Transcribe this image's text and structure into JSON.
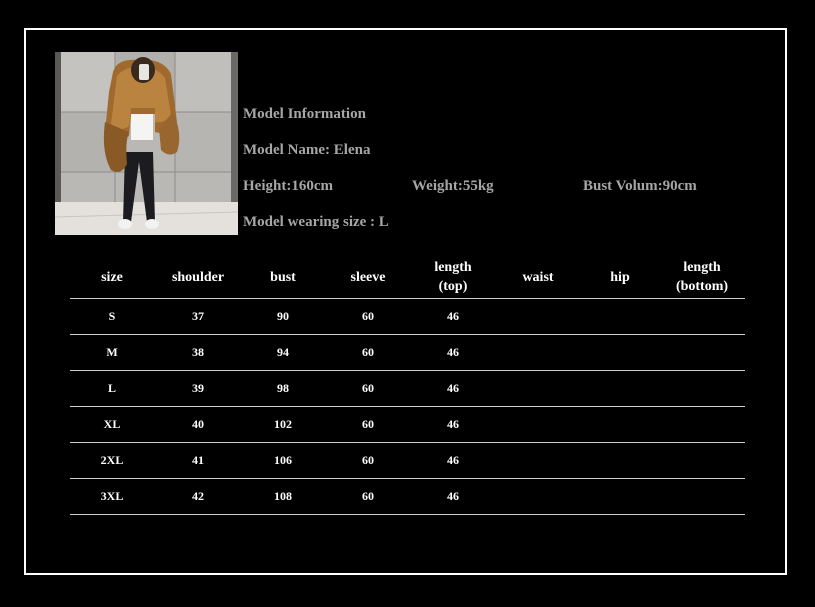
{
  "model": {
    "heading": "Model Information",
    "name": "Model Name: Elena",
    "height": "Height:160cm",
    "weight": "Weight:55kg",
    "bust": "Bust Volum:90cm",
    "wearing_size": "Model wearing size : L",
    "text_color": "#a6a6a6"
  },
  "table": {
    "headers": [
      [
        "size"
      ],
      [
        "shoulder"
      ],
      [
        "bust"
      ],
      [
        "sleeve"
      ],
      [
        "length",
        "(top)"
      ],
      [
        "waist"
      ],
      [
        "hip"
      ],
      [
        "length",
        "(bottom)"
      ]
    ],
    "rows": [
      [
        "S",
        "37",
        "90",
        "60",
        "46",
        "",
        "",
        ""
      ],
      [
        "M",
        "38",
        "94",
        "60",
        "46",
        "",
        "",
        ""
      ],
      [
        "L",
        "39",
        "98",
        "60",
        "46",
        "",
        "",
        ""
      ],
      [
        "XL",
        "40",
        "102",
        "60",
        "46",
        "",
        "",
        ""
      ],
      [
        "2XL",
        "41",
        "106",
        "60",
        "46",
        "",
        "",
        ""
      ],
      [
        "3XL",
        "42",
        "108",
        "60",
        "46",
        "",
        "",
        ""
      ]
    ]
  },
  "colors": {
    "background": "#000000",
    "border": "#ffffff",
    "table_text": "#ffffff",
    "rule": "#cfcfcf"
  }
}
